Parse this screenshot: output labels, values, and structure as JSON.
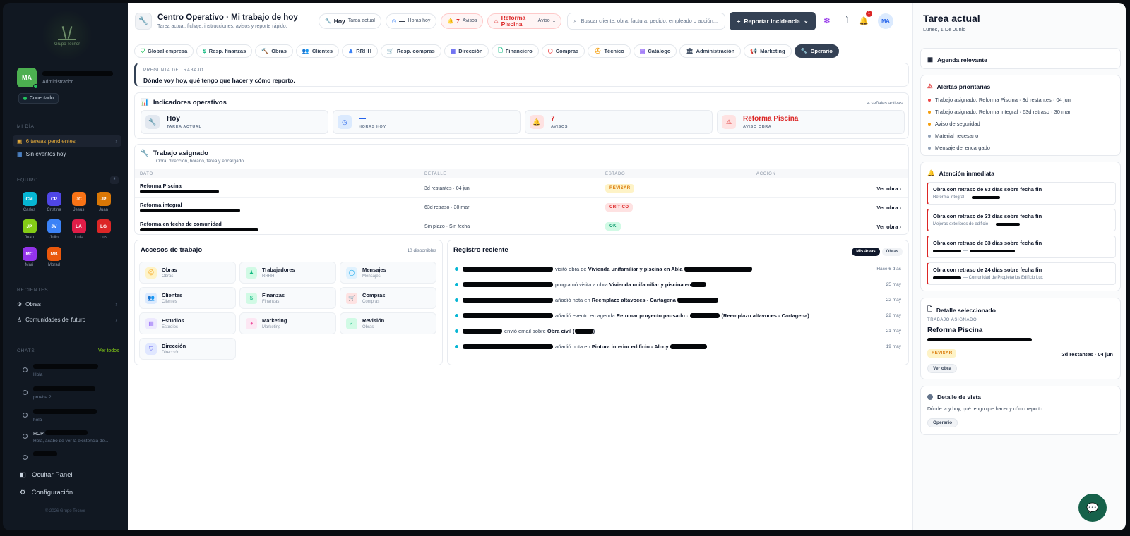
{
  "sidebar": {
    "logo_text": "Grupo Tecnor",
    "user": {
      "initials": "MA",
      "role": "Administrador"
    },
    "status": "Conectado",
    "my_day": {
      "title": "MI DÍA",
      "items": [
        "6 tareas pendientes",
        "Sin eventos hoy"
      ]
    },
    "team": {
      "title": "EQUIPO",
      "members": [
        {
          "initials": "CM",
          "name": "Carlos",
          "color": "#06b6d4"
        },
        {
          "initials": "CP",
          "name": "Cristina",
          "color": "#4f46e5"
        },
        {
          "initials": "JC",
          "name": "Jesus",
          "color": "#f97316"
        },
        {
          "initials": "JP",
          "name": "Juan",
          "color": "#d97706"
        },
        {
          "initials": "JP",
          "name": "Juan",
          "color": "#84cc16"
        },
        {
          "initials": "JV",
          "name": "Julio",
          "color": "#3b82f6"
        },
        {
          "initials": "LA",
          "name": "Luis",
          "color": "#e11d48"
        },
        {
          "initials": "LG",
          "name": "Luis",
          "color": "#dc2626"
        },
        {
          "initials": "MC",
          "name": "Mari",
          "color": "#9333ea"
        },
        {
          "initials": "MB",
          "name": "Morad",
          "color": "#ea580c"
        }
      ]
    },
    "recent": {
      "title": "RECIENTES",
      "items": [
        "Obras",
        "Comunidades del futuro"
      ]
    },
    "chats": {
      "title": "CHATS",
      "see_all": "Ver todos",
      "items": [
        {
          "preview": "Hola"
        },
        {
          "preview": "prueba 2"
        },
        {
          "preview": "hola"
        },
        {
          "name": "HCP",
          "preview": "Hola, acabo de ver la existencia de..."
        },
        {
          "preview": ""
        }
      ]
    },
    "hide_panel": "Ocultar Panel",
    "settings": "Configuración",
    "copyright": "© 2026 Grupo Tecnor"
  },
  "header": {
    "title": "Centro Operativo · Mi trabajo de hoy",
    "subtitle": "Tarea actual, fichaje, instrucciones, avisos y reporte rápido.",
    "chips": [
      {
        "value": "Hoy",
        "label": "Tarea actual"
      },
      {
        "value": "—",
        "label": "Horas hoy"
      },
      {
        "value": "7",
        "label": "Avisos"
      },
      {
        "value": "Reforma Piscina",
        "label": "Aviso ..."
      }
    ],
    "search_placeholder": "Buscar cliente, obra, factura, pedido, empleado o acción...",
    "report_button": "Reportar incidencia",
    "notif_count": "1",
    "avatar": "MA"
  },
  "tabs": [
    "Global empresa",
    "Resp. finanzas",
    "Obras",
    "Clientes",
    "RRHH",
    "Resp. compras",
    "Dirección",
    "Financiero",
    "Compras",
    "Técnico",
    "Catálogo",
    "Administración",
    "Marketing",
    "Operario"
  ],
  "question": {
    "label": "PREGUNTA DE TRABAJO",
    "text": "Dónde voy hoy, qué tengo que hacer y cómo reporto."
  },
  "indicators": {
    "title": "Indicadores operativos",
    "meta": "4 señales activas",
    "items": [
      {
        "value": "Hoy",
        "label": "TAREA ACTUAL"
      },
      {
        "value": "—",
        "label": "HORAS HOY"
      },
      {
        "value": "7",
        "label": "AVISOS"
      },
      {
        "value": "Reforma Piscina",
        "label": "AVISO OBRA"
      }
    ]
  },
  "assigned": {
    "title": "Trabajo asignado",
    "subtitle": "Obra, dirección, horario, tarea y encargado.",
    "columns": [
      "DATO",
      "DETALLE",
      "ESTADO",
      "ACCIÓN"
    ],
    "rows": [
      {
        "name": "Reforma Piscina",
        "detail": "3d restantes · 04 jun",
        "status": "REVISAR",
        "action": "Ver obra"
      },
      {
        "name": "Reforma integral",
        "detail": "63d retraso · 30 mar",
        "status": "CRÍTICO",
        "action": "Ver obra"
      },
      {
        "name": "Reforma en fecha de comunidad",
        "detail": "Sin plazo · Sin fecha",
        "status": "OK",
        "action": "Ver obra"
      }
    ]
  },
  "access": {
    "title": "Accesos de trabajo",
    "meta": "10 disponibles",
    "tiles": [
      {
        "label": "Obras",
        "sub": "Obras",
        "icon": "hardhat-icon",
        "glyph": "⛑",
        "color": "#f59e0b",
        "bg": "#fef3c7"
      },
      {
        "label": "Trabajadores",
        "sub": "RRHH",
        "icon": "users-icon",
        "glyph": "👥",
        "color": "#10b981",
        "bg": "#d1fae5"
      },
      {
        "label": "Mensajes",
        "sub": "Mensajes",
        "icon": "message-icon",
        "glyph": "💬",
        "color": "#0ea5e9",
        "bg": "#e0f2fe"
      },
      {
        "label": "Clientes",
        "sub": "Clientes",
        "icon": "clients-icon",
        "glyph": "👥",
        "color": "#3b82f6",
        "bg": "#dbeafe"
      },
      {
        "label": "Finanzas",
        "sub": "Finanzas",
        "icon": "dollar-icon",
        "glyph": "$",
        "color": "#10b981",
        "bg": "#d1fae5"
      },
      {
        "label": "Compras",
        "sub": "Compras",
        "icon": "cart-icon",
        "glyph": "🛒",
        "color": "#ef4444",
        "bg": "#fee2e2"
      },
      {
        "label": "Estudios",
        "sub": "Estudios",
        "icon": "document-icon",
        "glyph": "▤",
        "color": "#8b5cf6",
        "bg": "#ede9fe"
      },
      {
        "label": "Marketing",
        "sub": "Marketing",
        "icon": "palette-icon",
        "glyph": "◕",
        "color": "#ec4899",
        "bg": "#fce7f3"
      },
      {
        "label": "Revisión",
        "sub": "Obras",
        "icon": "clipboard-icon",
        "glyph": "✓",
        "color": "#10b981",
        "bg": "#d1fae5"
      },
      {
        "label": "Dirección",
        "sub": "Dirección",
        "icon": "shield-icon",
        "glyph": "⛉",
        "color": "#6366f1",
        "bg": "#e0e7ff"
      }
    ]
  },
  "registry": {
    "title": "Registro reciente",
    "toggle": [
      "Mis áreas",
      "Obras"
    ],
    "items": [
      {
        "action": "visitó obra de",
        "target": "Vivienda unifamiliar y piscina en Abla",
        "date": "Hace 6 días"
      },
      {
        "action": "programó visita a obra",
        "target": "Vivienda unifamiliar y piscina en",
        "date": "25 may"
      },
      {
        "action": "añadió nota en",
        "target": "Reemplazo altavoces - Cartagena",
        "date": "22 may"
      },
      {
        "action": "añadió evento en agenda",
        "target": "Retomar proyecto pausado",
        "extra": "(Reemplazo altavoces - Cartagena)",
        "date": "22 may"
      },
      {
        "action": "envió email sobre",
        "target": "Obra civil (",
        "date": "21 may"
      },
      {
        "action": "añadió nota en",
        "target": "Pintura interior edificio - Alcoy",
        "date": "19 may"
      }
    ]
  },
  "right_panel": {
    "title": "Tarea actual",
    "date": "Lunes, 1 De Junio",
    "agenda": "Agenda relevante",
    "alerts": {
      "title": "Alertas prioritarias",
      "items": [
        {
          "text": "Trabajo asignado: Reforma Piscina · 3d restantes · 04 jun",
          "color": "#ef4444"
        },
        {
          "text": "Trabajo asignado: Reforma integral · 63d retraso · 30 mar",
          "color": "#f59e0b"
        },
        {
          "text": "Aviso de seguridad",
          "color": "#f59e0b"
        },
        {
          "text": "Material necesario",
          "color": "#94a3b8"
        },
        {
          "text": "Mensaje del encargado",
          "color": "#94a3b8"
        }
      ]
    },
    "attention": {
      "title": "Atención inmediata",
      "items": [
        {
          "title": "Obra con retraso de 63 días sobre fecha fin",
          "sub": "Reforma integral —"
        },
        {
          "title": "Obra con retraso de 33 días sobre fecha fin",
          "sub": "Mejoras exteriores de edificio —"
        },
        {
          "title": "Obra con retraso de 33 días sobre fecha fin",
          "sub": "—"
        },
        {
          "title": "Obra con retraso de 24 días sobre fecha fin",
          "sub": "— Comunidad de Propietarios Edificio Lux"
        }
      ]
    },
    "detail": {
      "title": "Detalle seleccionado",
      "label": "TRABAJO ASIGNADO",
      "name": "Reforma Piscina",
      "status": "REVISAR",
      "time": "3d restantes · 04 jun",
      "button": "Ver obra"
    },
    "view": {
      "title": "Detalle de vista",
      "text": "Dónde voy hoy, qué tengo que hacer y cómo reporto.",
      "tag": "Operario"
    }
  }
}
